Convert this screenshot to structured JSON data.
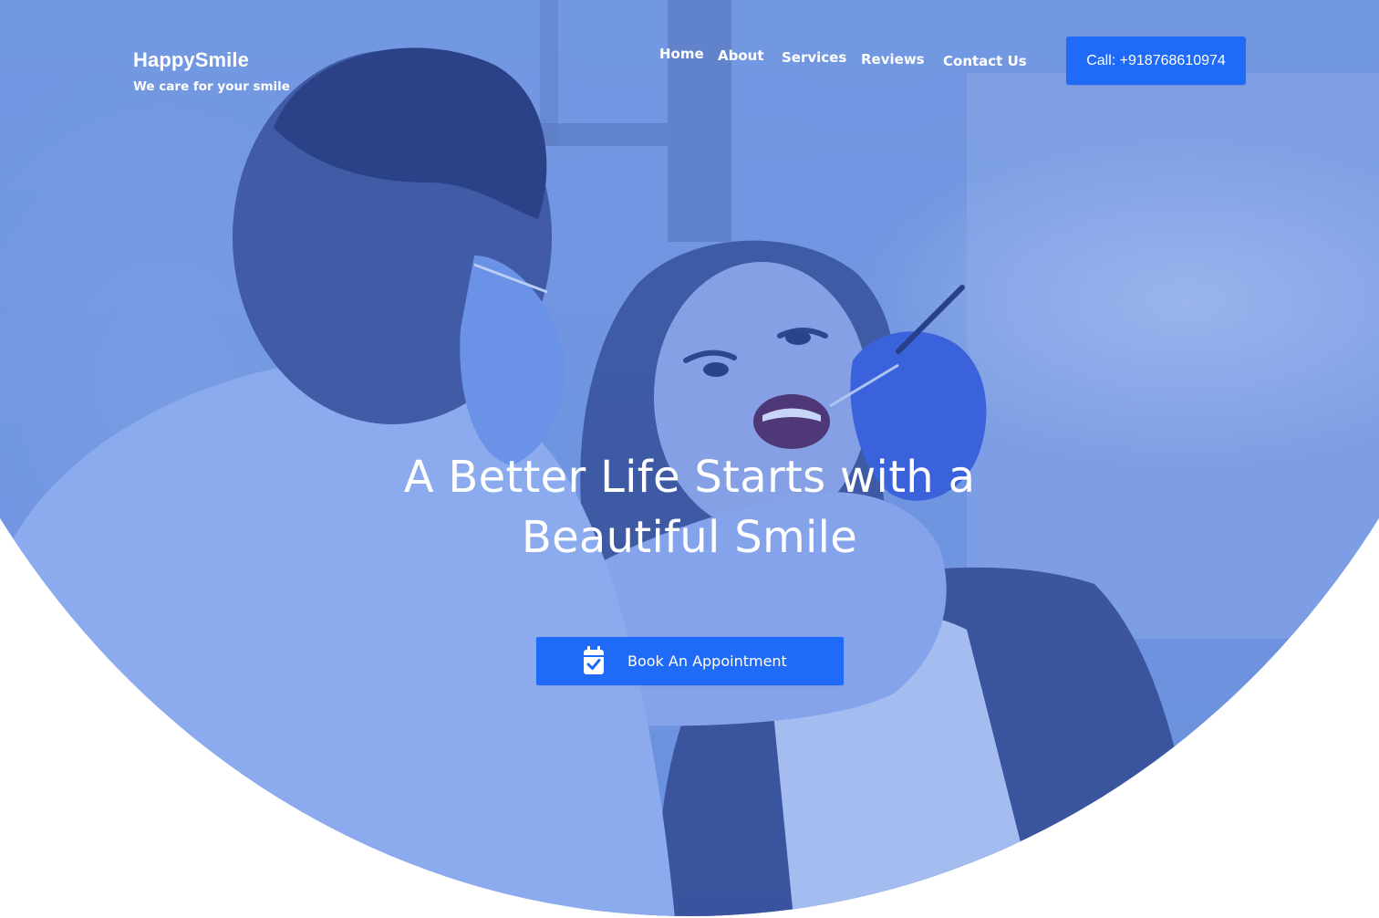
{
  "brand": {
    "name": "HappySmile",
    "tagline": "We care for your smile"
  },
  "nav": {
    "items": [
      {
        "label": "Home"
      },
      {
        "label": "About"
      },
      {
        "label": "Services"
      },
      {
        "label": "Reviews"
      },
      {
        "label": "Contact Us"
      }
    ],
    "call_label": "Call: +918768610974"
  },
  "hero": {
    "headline_line1": "A Better Life Starts with a",
    "headline_line2": "Beautiful Smile",
    "cta_label": "Book An Appointment",
    "cta_icon": "calendar-check-icon",
    "image": "dentist-examining-patient-photo"
  },
  "colors": {
    "accent": "#1f6bf7",
    "overlay": "#2660e6",
    "text": "#ffffff",
    "background": "#ffffff"
  }
}
